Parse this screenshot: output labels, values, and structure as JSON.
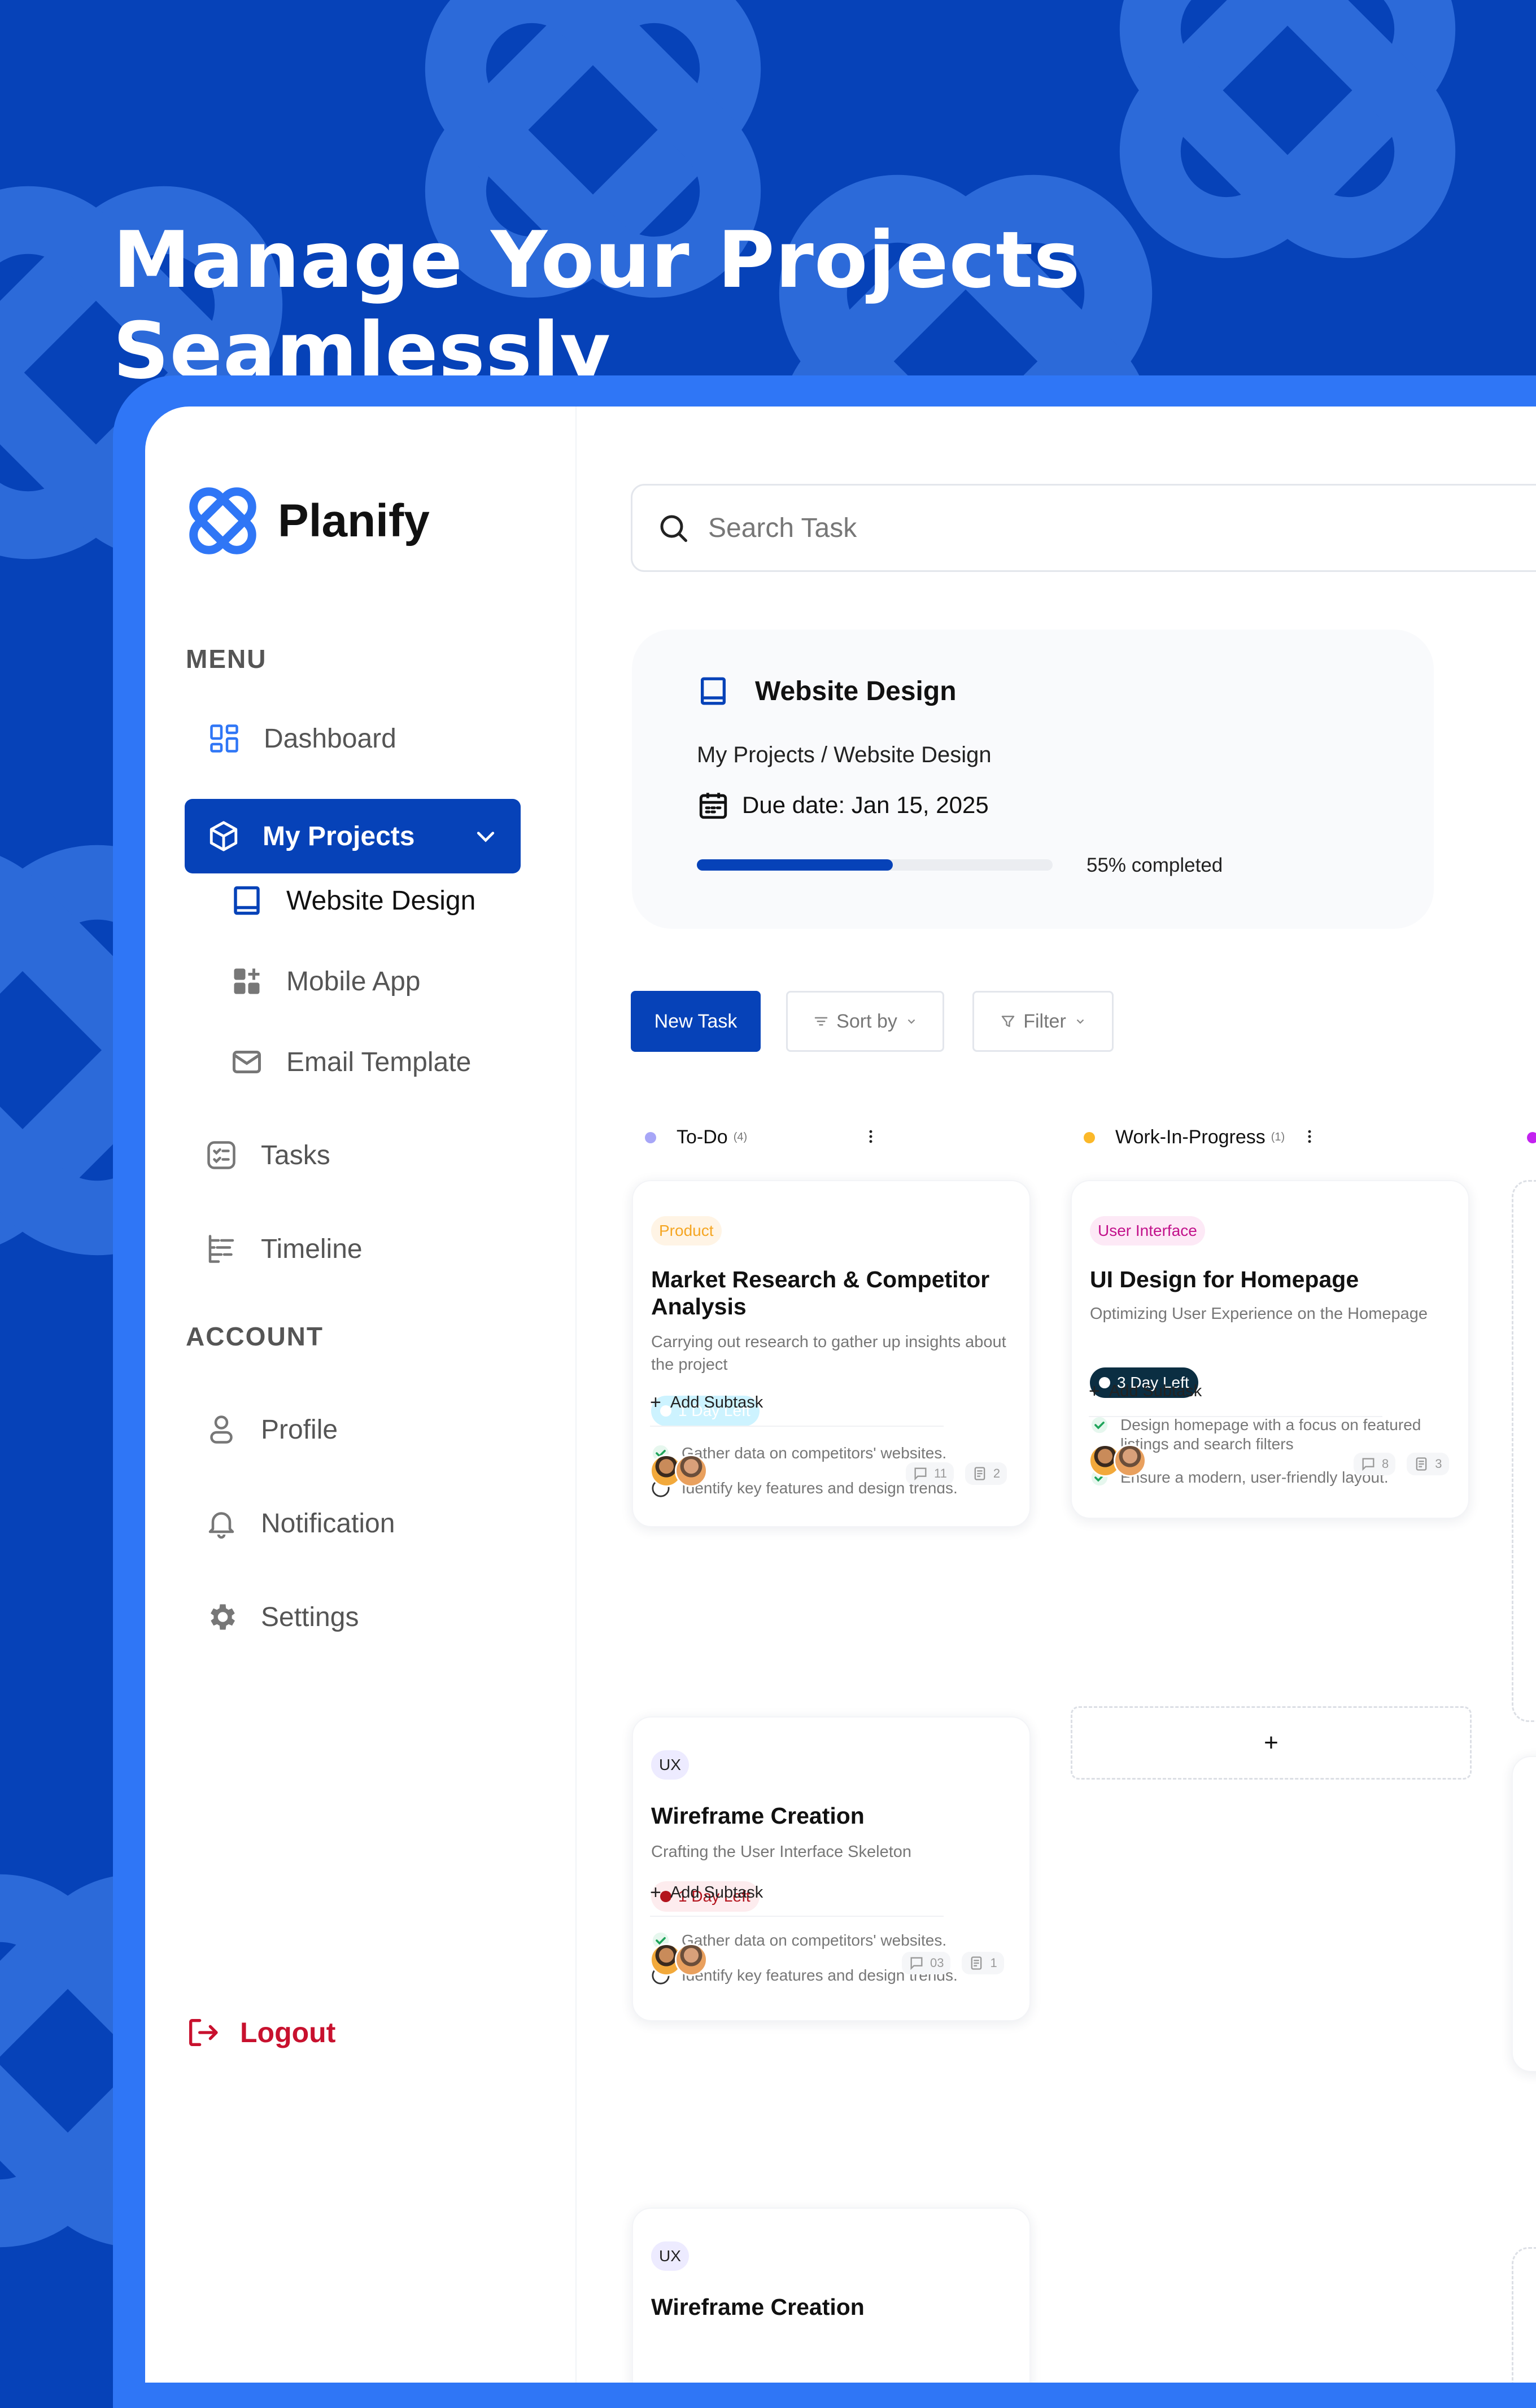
{
  "hero": {
    "title": "Manage Your Projects Seamlessly"
  },
  "colors": {
    "brand": "#0642B8",
    "frame": "#2F76F6",
    "danger": "#C8112E"
  },
  "app": {
    "name": "Planify"
  },
  "sidebar": {
    "menu_label": "MENU",
    "dashboard": "Dashboard",
    "my_projects": "My Projects",
    "projects": [
      {
        "label": "Website Design",
        "icon": "book-icon"
      },
      {
        "label": "Mobile App",
        "icon": "apps-icon"
      },
      {
        "label": "Email Template",
        "icon": "mail-icon"
      }
    ],
    "tasks": "Tasks",
    "timeline": "Timeline",
    "account_label": "ACCOUNT",
    "profile": "Profile",
    "notification": "Notification",
    "settings": "Settings",
    "logout": "Logout"
  },
  "search": {
    "placeholder": "Search Task"
  },
  "project": {
    "title": "Website Design",
    "breadcrumb": "My Projects / Website Design",
    "due": "Due date: Jan 15, 2025",
    "progress": 0.55,
    "progress_text": "55% completed"
  },
  "toolbar": {
    "new_task": "New Task",
    "sort": "Sort by",
    "filter": "Filter"
  },
  "columns": [
    {
      "name": "To-Do",
      "count": "(4)",
      "color": "#A7A6F7"
    },
    {
      "name": "Work-In-Progress",
      "count": "(1)",
      "color": "#FBB829"
    }
  ],
  "third_column_dot": "#C322F0",
  "cards": {
    "c1": {
      "tag": "Product",
      "title": "Market Research & Competitor Analysis",
      "desc": "Carrying out research to gather up insights about the project",
      "badge": "1 Day Left",
      "sub1": "Gather data on competitors' websites.",
      "sub2": "Identify key features and design trends.",
      "add": "Add Subtask",
      "comments": "11",
      "files": "2"
    },
    "c2": {
      "tag": "UX",
      "title": "Wireframe Creation",
      "desc": "Crafting the User Interface Skeleton",
      "badge": "1 Day Left",
      "sub1": "Gather data on competitors' websites.",
      "sub2": "Identify key features and design trends.",
      "add": "Add Subtask",
      "comments": "03",
      "files": "1"
    },
    "c3": {
      "tag": "UX",
      "title": "Wireframe Creation"
    },
    "w1": {
      "tag": "User Interface",
      "title": "UI Design for Homepage",
      "desc": "Optimizing User Experience on the Homepage",
      "badge": "3 Day Left",
      "sub1": "Design homepage with a focus on featured listings and search filters",
      "sub2": "Ensure a modern, user-friendly layout.",
      "add": "Add Subtask",
      "comments": "8",
      "files": "3"
    },
    "add_card": "+"
  }
}
